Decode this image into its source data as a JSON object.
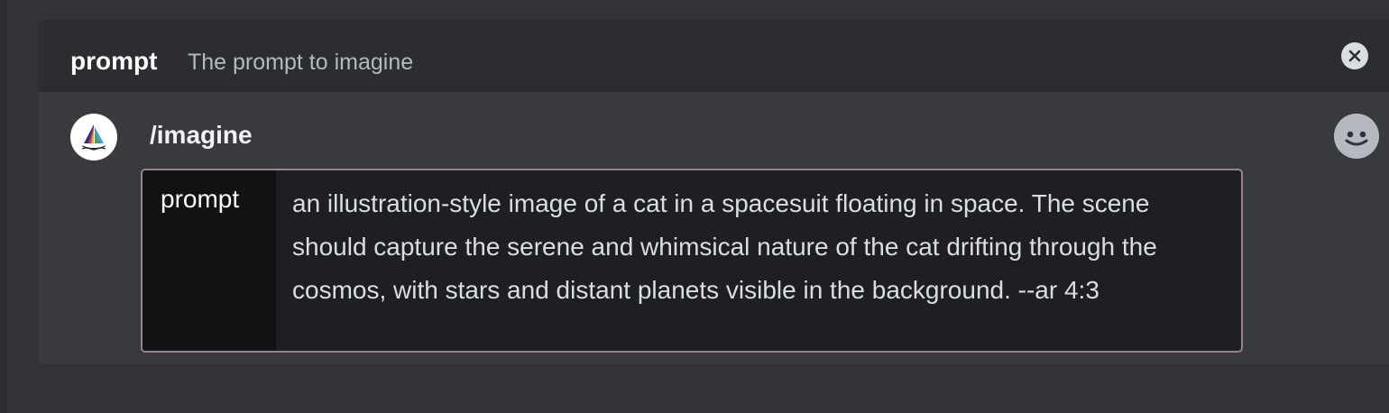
{
  "autocomplete": {
    "option_name": "prompt",
    "option_description": "The prompt to imagine",
    "close_icon": "close-icon"
  },
  "command": {
    "bot_avatar_icon": "sailboat-logo-icon",
    "name": "/imagine",
    "emoji_icon": "smiley-face-icon"
  },
  "input": {
    "option_label": "prompt",
    "option_value": "an illustration-style image of a cat in a spacesuit floating in space. The scene should capture the serene and whimsical nature of the cat drifting through the cosmos, with stars and distant planets visible in the background. --ar 4:3"
  },
  "colors": {
    "background": "#313338",
    "popup": "#383a40",
    "header": "#2b2d31",
    "input_border": "#a07f8c"
  }
}
